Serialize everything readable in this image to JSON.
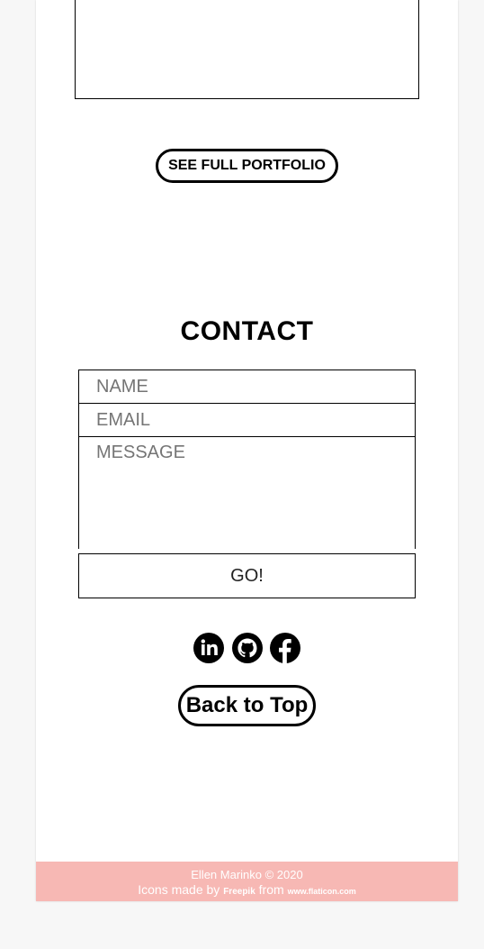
{
  "portfolio": {
    "see_full_label": "SEE FULL PORTFOLIO"
  },
  "contact": {
    "title": "CONTACT",
    "name_placeholder": "NAME",
    "email_placeholder": "EMAIL",
    "message_placeholder": "MESSAGE",
    "submit_label": "GO!"
  },
  "social": {
    "icons": [
      "linkedin-icon",
      "github-icon",
      "facebook-icon"
    ]
  },
  "back_to_top_label": "Back to Top",
  "footer": {
    "copyright": "Ellen Marinko © 2020",
    "icons_prefix": "Icons made by",
    "author": "Freepik",
    "from_word": "from",
    "site": "www.flaticon.com",
    "background_color": "#f7b8b4"
  }
}
